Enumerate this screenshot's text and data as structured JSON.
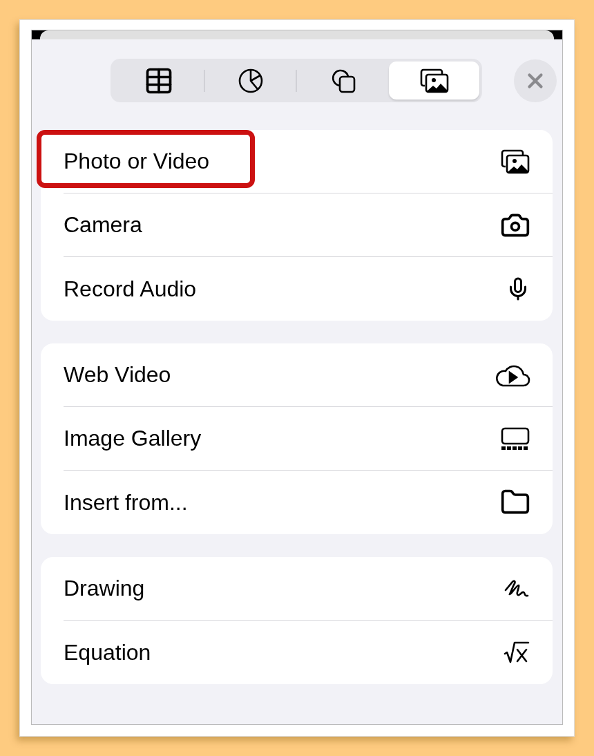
{
  "tabs": [
    {
      "selected": false
    },
    {
      "selected": false
    },
    {
      "selected": false
    },
    {
      "selected": true
    }
  ],
  "groups": [
    {
      "items": [
        {
          "label": "Photo or Video",
          "highlighted": true
        },
        {
          "label": "Camera",
          "highlighted": false
        },
        {
          "label": "Record Audio",
          "highlighted": false
        }
      ]
    },
    {
      "items": [
        {
          "label": "Web Video",
          "highlighted": false
        },
        {
          "label": "Image Gallery",
          "highlighted": false
        },
        {
          "label": "Insert from...",
          "highlighted": false
        }
      ]
    },
    {
      "items": [
        {
          "label": "Drawing",
          "highlighted": false
        },
        {
          "label": "Equation",
          "highlighted": false
        }
      ]
    }
  ]
}
